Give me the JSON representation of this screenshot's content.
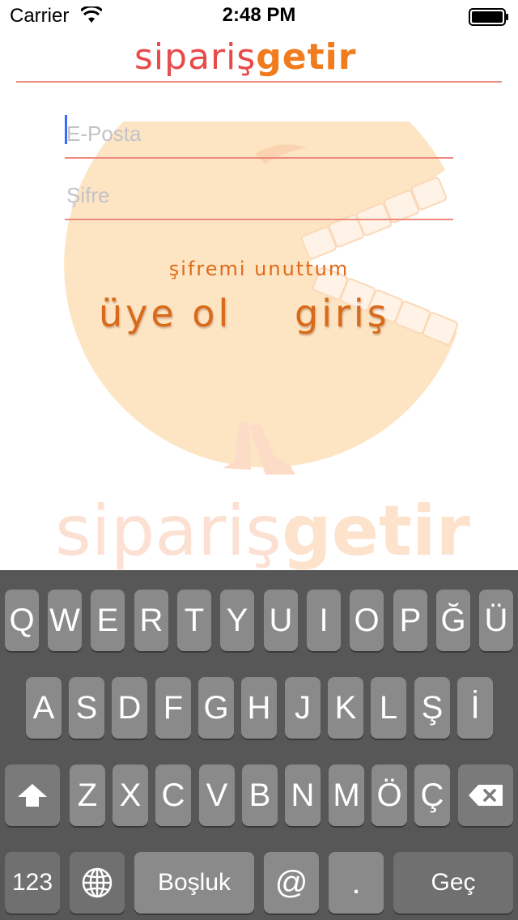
{
  "status_bar": {
    "carrier": "Carrier",
    "time": "2:48 PM"
  },
  "logo": {
    "part1": "sipariş",
    "part2": "getir"
  },
  "form": {
    "email_placeholder": "E-Posta",
    "password_placeholder": "Şifre",
    "forgot_password": "şifremi unuttum",
    "signup": "üye ol",
    "login": "giriş"
  },
  "watermark": {
    "part1": "sipariş",
    "part2": "getir"
  },
  "colors": {
    "brand_red": "#e84a4a",
    "brand_orange": "#f07c1d",
    "keyboard_bg": "#575757",
    "key_bg": "#8a8a8a"
  },
  "keyboard": {
    "row1": [
      "Q",
      "W",
      "E",
      "R",
      "T",
      "Y",
      "U",
      "I",
      "O",
      "P",
      "Ğ",
      "Ü"
    ],
    "row2": [
      "A",
      "S",
      "D",
      "F",
      "G",
      "H",
      "J",
      "K",
      "L",
      "Ş",
      "İ"
    ],
    "row3": [
      "Z",
      "X",
      "C",
      "V",
      "B",
      "N",
      "M",
      "Ö",
      "Ç"
    ],
    "numbers": "123",
    "space": "Boşluk",
    "at": "@",
    "dot": ".",
    "go": "Geç",
    "icons": {
      "shift": "shift-icon",
      "backspace": "backspace-icon",
      "globe": "globe-icon"
    }
  }
}
